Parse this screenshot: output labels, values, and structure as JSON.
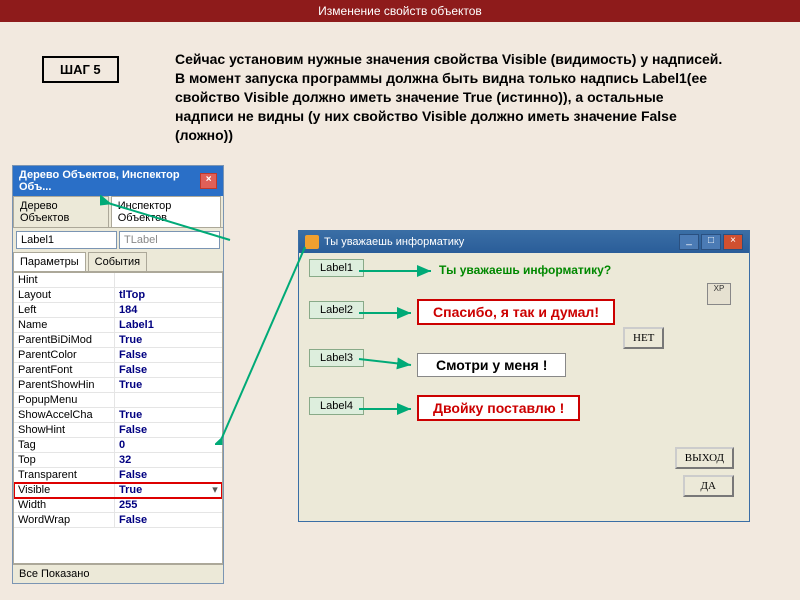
{
  "title": "Изменение свойств объектов",
  "step_label": "ШАГ 5",
  "instruction": "Сейчас установим нужные значения свойства Visible (видимость) у надписей. В момент запуска программы должна быть видна только надпись Label1(ее свойство Visible должно иметь значение True (истинно)), а остальные надписи не видны (у них свойство Visible должно иметь значение False (ложно))",
  "inspector": {
    "title": "Дерево Объектов, Инспектор Объ...",
    "tab1": "Дерево Объектов",
    "tab2": "Инспектор Объектов",
    "sel_name": "Label1",
    "sel_type": "TLabel",
    "subtab1": "Параметры",
    "subtab2": "События",
    "status": "Все Показано",
    "rows": [
      {
        "n": "Hint",
        "v": ""
      },
      {
        "n": "Layout",
        "v": "tlTop"
      },
      {
        "n": "Left",
        "v": "184"
      },
      {
        "n": "Name",
        "v": "Label1"
      },
      {
        "n": "ParentBiDiMod",
        "v": "True"
      },
      {
        "n": "ParentColor",
        "v": "False"
      },
      {
        "n": "ParentFont",
        "v": "False"
      },
      {
        "n": "ParentShowHin",
        "v": "True"
      },
      {
        "n": "PopupMenu",
        "v": ""
      },
      {
        "n": "ShowAccelCha",
        "v": "True"
      },
      {
        "n": "ShowHint",
        "v": "False"
      },
      {
        "n": "Tag",
        "v": "0"
      },
      {
        "n": "Top",
        "v": "32"
      },
      {
        "n": "Transparent",
        "v": "False"
      },
      {
        "n": "Visible",
        "v": "True",
        "highlight": true,
        "dd": true
      },
      {
        "n": "Width",
        "v": "255"
      },
      {
        "n": "WordWrap",
        "v": "False"
      }
    ]
  },
  "app": {
    "title": "Ты уважаешь информатику",
    "question": "Ты уважаешь информатику?",
    "labels": {
      "l1": "Label1",
      "l2": "Label2",
      "l3": "Label3",
      "l4": "Label4"
    },
    "msg1": "Спасибо, я так и думал!",
    "msg2": "Смотри у меня !",
    "msg3": "Двойку поставлю !",
    "btn_no": "НЕТ",
    "btn_exit": "ВЫХОД",
    "btn_yes": "ДА",
    "xp": "XP"
  }
}
